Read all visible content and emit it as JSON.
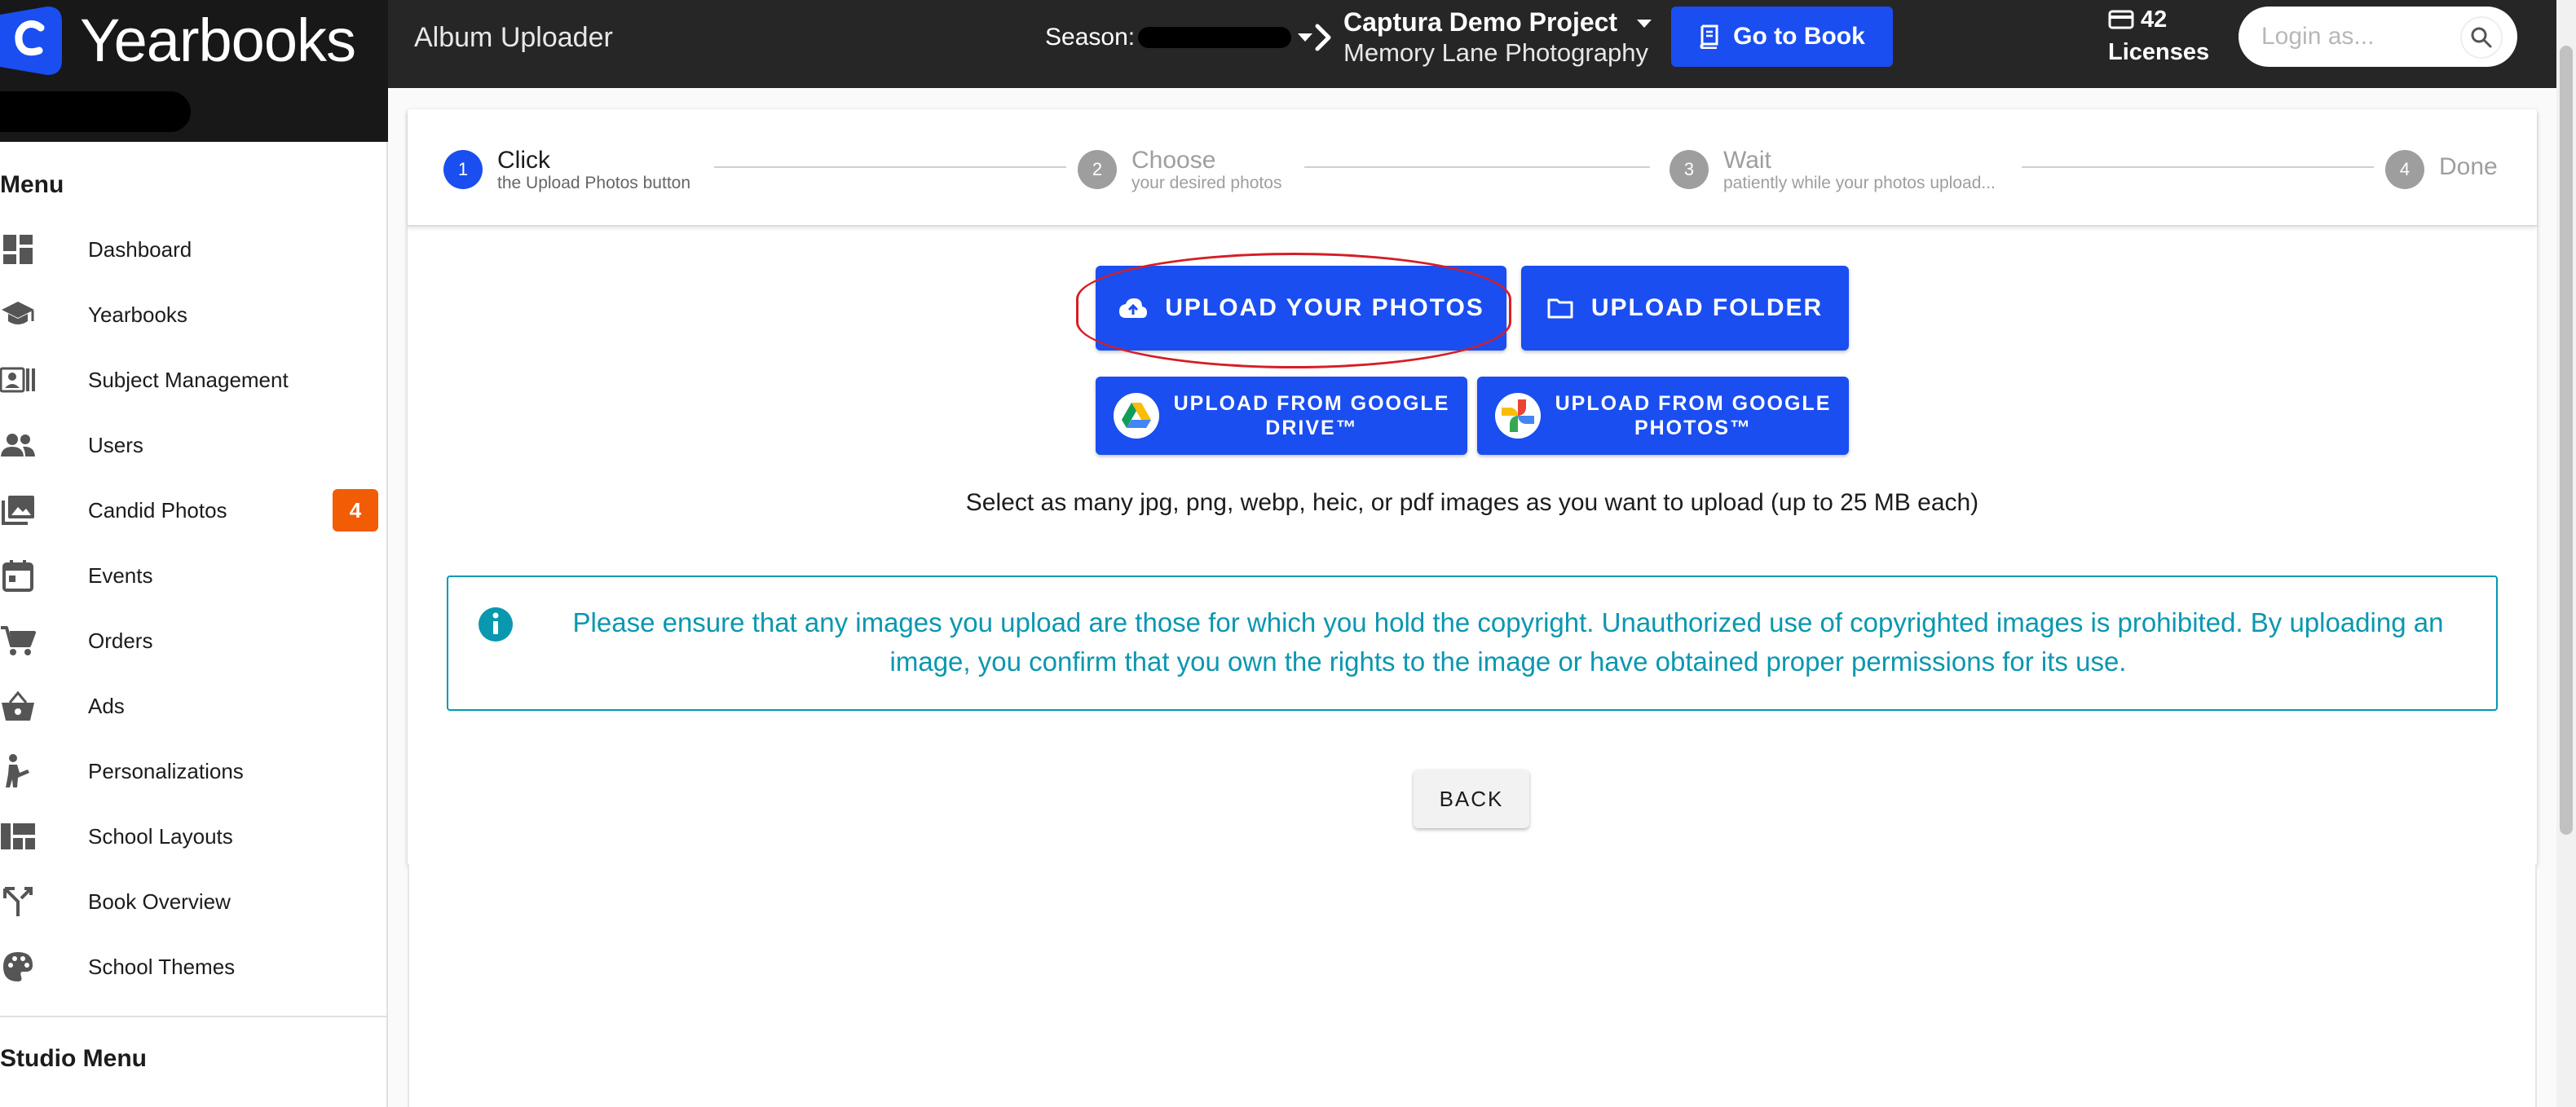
{
  "brand": {
    "name": "Yearbooks"
  },
  "header": {
    "app_title": "Album Uploader",
    "season_label": "Season:",
    "project_name": "Captura Demo Project",
    "studio_name": "Memory Lane Photography",
    "go_to_book_label": "Go to Book",
    "licenses_count": "42",
    "licenses_label": "Licenses",
    "login_placeholder": "Login as..."
  },
  "sidebar": {
    "menu_heading": "Menu",
    "items": [
      {
        "label": "Dashboard",
        "icon": "dashboard-icon"
      },
      {
        "label": "Yearbooks",
        "icon": "graduation-cap-icon"
      },
      {
        "label": "Subject Management",
        "icon": "contacts-icon"
      },
      {
        "label": "Users",
        "icon": "users-icon"
      },
      {
        "label": "Candid Photos",
        "icon": "photo-library-icon",
        "badge": "4"
      },
      {
        "label": "Events",
        "icon": "calendar-icon"
      },
      {
        "label": "Orders",
        "icon": "cart-icon"
      },
      {
        "label": "Ads",
        "icon": "basket-icon"
      },
      {
        "label": "Personalizations",
        "icon": "person-icon"
      },
      {
        "label": "School Layouts",
        "icon": "layout-icon"
      },
      {
        "label": "Book Overview",
        "icon": "merge-icon"
      },
      {
        "label": "School Themes",
        "icon": "palette-icon"
      }
    ],
    "studio_heading": "Studio Menu"
  },
  "stepper": {
    "steps": [
      {
        "num": "1",
        "title": "Click",
        "subtitle": "the Upload Photos button",
        "state": "active"
      },
      {
        "num": "2",
        "title": "Choose",
        "subtitle": "your desired photos",
        "state": "inactive"
      },
      {
        "num": "3",
        "title": "Wait",
        "subtitle": "patiently while your photos upload...",
        "state": "inactive"
      },
      {
        "num": "4",
        "title": "Done",
        "subtitle": "",
        "state": "inactive"
      }
    ]
  },
  "upload": {
    "photos_label": "UPLOAD YOUR PHOTOS",
    "folder_label": "UPLOAD FOLDER",
    "drive_label_line1": "UPLOAD FROM GOOGLE",
    "drive_label_line2": "DRIVE™",
    "gphotos_label_line1": "UPLOAD FROM GOOGLE",
    "gphotos_label_line2": "PHOTOS™",
    "hint": "Select as many jpg, png, webp, heic, or pdf images as you want to upload (up to 25 MB each)"
  },
  "alert": {
    "text": "Please ensure that any images you upload are those for which you hold the copyright. Unauthorized use of copyrighted images is prohibited. By uploading an image, you confirm that you own the rights to the image or have obtained proper permissions for its use."
  },
  "back_label": "BACK",
  "colors": {
    "primary": "#1a4ef0",
    "topbar": "#262626",
    "badge": "#f25c05",
    "info": "#0a97b0",
    "step_active": "#1a4ef0",
    "step_inactive": "#9e9e9e",
    "highlight": "#d51e24"
  }
}
